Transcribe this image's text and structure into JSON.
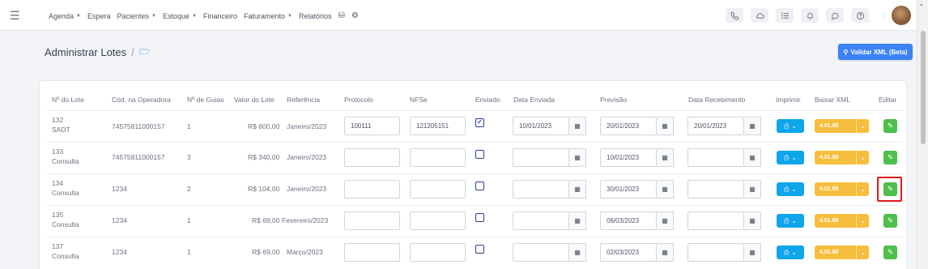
{
  "nav": {
    "items": [
      {
        "label": "Agenda",
        "dropdown": true
      },
      {
        "label": "Espera",
        "dropdown": false
      },
      {
        "label": "Pacientes",
        "dropdown": true
      },
      {
        "label": "Estoque",
        "dropdown": true
      },
      {
        "label": "Financeiro",
        "dropdown": false
      },
      {
        "label": "Faturamento",
        "dropdown": true
      },
      {
        "label": "Relatórios",
        "dropdown": false
      }
    ],
    "icons": [
      "database-icon",
      "settings-icon"
    ]
  },
  "toolbar_icons": [
    "phone-icon",
    "cloud-icon",
    "list-icon",
    "bell-icon",
    "chat-icon",
    "help-icon"
  ],
  "page": {
    "title": "Administrar Lotes",
    "separator": "/",
    "validate_button": "Validar XML (Beta)"
  },
  "table": {
    "headers": [
      "Nº do Lote",
      "Cód. na Operadora",
      "Nº de Guias",
      "Valor do Lote",
      "Referência",
      "Protocolo",
      "NFSe",
      "Enviado",
      "Data Enviada",
      "Previsão",
      "Data Recebimento",
      "Imprimir",
      "Baixar XML",
      "Editar"
    ],
    "rows": [
      {
        "lot": "132",
        "type": "SADT",
        "operator_code": "74575811000157",
        "guides": "1",
        "value": "R$ 600,00",
        "reference": "Janeiro/2023",
        "protocol": "100111",
        "nfse": "121205151",
        "sent": true,
        "sent_date": "10/01/2023",
        "forecast": "20/01/2023",
        "received": "20/01/2023",
        "xml_version": "4.01.00"
      },
      {
        "lot": "133",
        "type": "Consulta",
        "operator_code": "74575811000157",
        "guides": "3",
        "value": "R$ 340,00",
        "reference": "Janeiro/2023",
        "protocol": "",
        "nfse": "",
        "sent": false,
        "sent_date": "",
        "forecast": "10/01/2023",
        "received": "",
        "xml_version": "4.01.00"
      },
      {
        "lot": "134",
        "type": "Consulta",
        "operator_code": "1234",
        "guides": "2",
        "value": "R$ 104,00",
        "reference": "Janeiro/2023",
        "protocol": "",
        "nfse": "",
        "sent": false,
        "sent_date": "",
        "forecast": "30/01/2023",
        "received": "",
        "xml_version": "4.01.00"
      },
      {
        "lot": "135",
        "type": "Consulta",
        "operator_code": "1234",
        "guides": "1",
        "value": "R$ 69,00",
        "reference": "Fevereiro/2023",
        "protocol": "",
        "nfse": "",
        "sent": false,
        "sent_date": "",
        "forecast": "06/03/2023",
        "received": "",
        "xml_version": "4.01.00"
      },
      {
        "lot": "137",
        "type": "Consulta",
        "operator_code": "1234",
        "guides": "1",
        "value": "R$ 69,00",
        "reference": "Março/2023",
        "protocol": "",
        "nfse": "",
        "sent": false,
        "sent_date": "",
        "forecast": "02/03/2023",
        "received": "",
        "xml_version": "4.01.00"
      }
    ]
  },
  "colors": {
    "accent": "#3b82f6",
    "print_button": "#0ea5e9",
    "xml_button": "#f7be3e",
    "edit_button": "#4cbf4c",
    "highlight": "#e01a1a"
  }
}
